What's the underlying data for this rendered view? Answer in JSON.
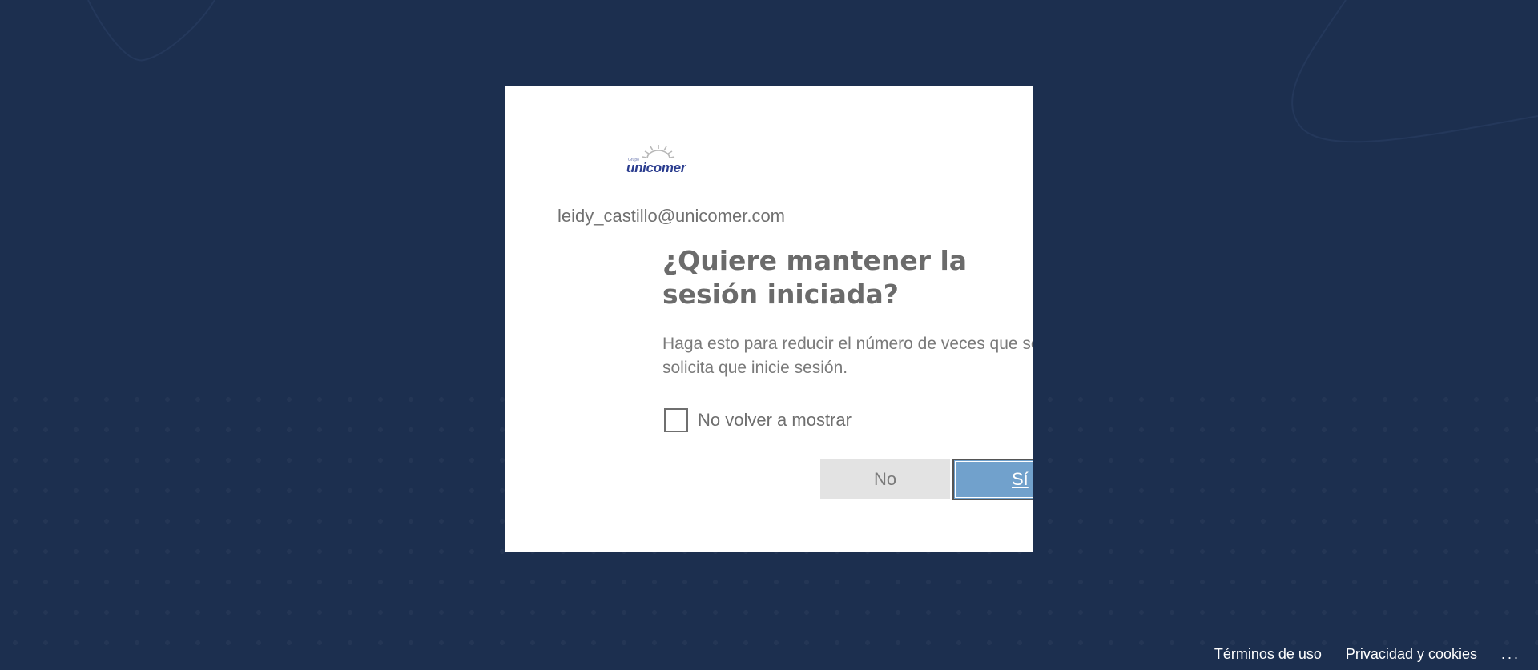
{
  "account": {
    "logo_text": "unicomer",
    "logo_small_text": "Grupo",
    "identity": "leidy_castillo@unicomer.com"
  },
  "prompt": {
    "title": "¿Quiere mantener la sesión iniciada?",
    "description": "Haga esto para reducir el número de veces que se le solicita que inicie sesión.",
    "checkbox_label": "No volver a mostrar",
    "checkbox_checked": false
  },
  "buttons": {
    "no_label": "No",
    "yes_label": "Sí"
  },
  "footer": {
    "terms": "Términos de uso",
    "privacy": "Privacidad y cookies",
    "more": "..."
  },
  "colors": {
    "background": "#1c2f4f",
    "primary_button": "#71a1cc",
    "secondary_button": "#e3e3e3",
    "logo_blue": "#2b3d8f"
  }
}
